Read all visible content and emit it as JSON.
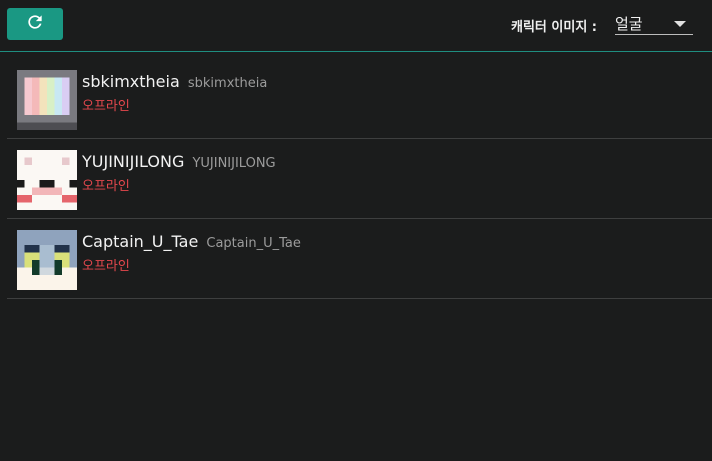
{
  "toolbar": {
    "refresh_icon": "refresh-icon",
    "char_image_label": "캐릭터 이미지 :",
    "char_image_value": "얼굴",
    "accent_color": "#1a9883"
  },
  "friends": [
    {
      "name": "sbkimxtheia",
      "handle": "sbkimxtheia",
      "status": "오프라인",
      "avatar": "rainbow-face-avatar"
    },
    {
      "name": "YUJINIJILONG",
      "handle": "YUJINIJILONG",
      "status": "오프라인",
      "avatar": "white-bear-face-avatar"
    },
    {
      "name": "Captain_U_Tae",
      "handle": "Captain_U_Tae",
      "status": "오프라인",
      "avatar": "captain-face-avatar"
    }
  ],
  "colors": {
    "offline": "#e5484d"
  }
}
